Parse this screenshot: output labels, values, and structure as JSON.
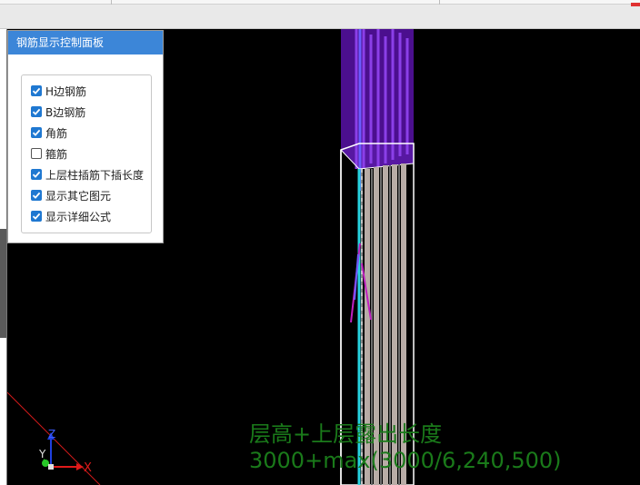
{
  "panel": {
    "title": "钢筋显示控制面板",
    "options": [
      {
        "label": "H边钢筋",
        "checked": true
      },
      {
        "label": "B边钢筋",
        "checked": true
      },
      {
        "label": "角筋",
        "checked": true
      },
      {
        "label": "箍筋",
        "checked": false
      },
      {
        "label": "上层柱插筋下插长度",
        "checked": true
      },
      {
        "label": "显示其它图元",
        "checked": true
      },
      {
        "label": "显示详细公式",
        "checked": true
      }
    ]
  },
  "formula": {
    "line1": "层高+上层露出长度",
    "line2": "3000+max(3000/6,240,500)"
  },
  "axes": {
    "x_label": "X",
    "y_label": "Y",
    "z_label": "Z"
  },
  "colors": {
    "panel_header": "#3c86d8",
    "checkbox": "#1f78d1",
    "formula_text": "#1a7a1a",
    "upper_column": "#4b0f8e",
    "rebar_light": "#b8aca6",
    "rebar_upper": "#7f33d9",
    "highlight_rebar": "#27d3e0"
  }
}
